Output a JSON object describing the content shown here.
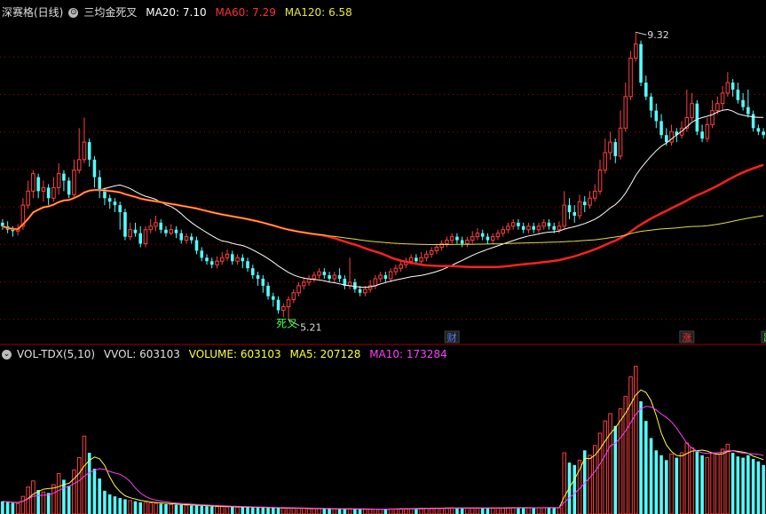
{
  "header_top": {
    "name": "深赛格(日线)",
    "indicator": "三均金死叉",
    "ma20_label": "MA20:",
    "ma20_value": "7.10",
    "ma60_label": "MA60:",
    "ma60_value": "7.29",
    "ma120_label": "MA120:",
    "ma120_value": "6.58"
  },
  "header_bottom": {
    "indicator": "VOL-TDX(5,10)",
    "vvol_label": "VVOL:",
    "vvol_value": "603103",
    "volume_label": "VOLUME:",
    "volume_value": "603103",
    "ma5_label": "MA5:",
    "ma5_value": "207128",
    "ma10_label": "MA10:",
    "ma10_value": "173284"
  },
  "colors": {
    "background": "#000000",
    "up": "#ff4040",
    "down": "#54ffff",
    "ma20": "#ffffff",
    "ma60": "#ff2020",
    "ma120": "#e0e040",
    "vol_ma5": "#ffff40",
    "vol_ma10": "#ff40ff",
    "grid": "#a00000",
    "signal_death": "#40ff40"
  },
  "chart_data": {
    "type": "candlestick",
    "price_ylim": [
      4.9,
      9.5
    ],
    "volume_ylim": [
      0,
      620000
    ],
    "annotations": {
      "high_label": "9.32",
      "low_label": "5.21",
      "death_cross_label": "死叉",
      "markers": [
        {
          "text": "财",
          "index": 88,
          "color": "#5080ff"
        },
        {
          "text": "涨",
          "index": 134,
          "color": "#ff3030"
        },
        {
          "text": "跌",
          "index": 150,
          "color": "#40ff40"
        }
      ]
    },
    "candles": [
      [
        6.6,
        6.55,
        6.65,
        6.5
      ],
      [
        6.55,
        6.5,
        6.62,
        6.45
      ],
      [
        6.5,
        6.48,
        6.55,
        6.4
      ],
      [
        6.48,
        6.5,
        6.58,
        6.42
      ],
      [
        6.55,
        6.85,
        6.95,
        6.5
      ],
      [
        6.85,
        7.05,
        7.2,
        6.8
      ],
      [
        7.05,
        7.3,
        7.35,
        6.95
      ],
      [
        7.25,
        7.05,
        7.3,
        6.95
      ],
      [
        7.05,
        7.1,
        7.2,
        6.9
      ],
      [
        7.1,
        6.95,
        7.15,
        6.85
      ],
      [
        6.95,
        7.1,
        7.25,
        6.9
      ],
      [
        7.1,
        7.3,
        7.45,
        7.0
      ],
      [
        7.3,
        7.2,
        7.35,
        7.05
      ],
      [
        7.2,
        7.0,
        7.25,
        6.95
      ],
      [
        7.0,
        7.35,
        7.5,
        6.95
      ],
      [
        7.35,
        7.5,
        7.95,
        7.3
      ],
      [
        7.5,
        7.75,
        8.1,
        7.45
      ],
      [
        7.75,
        7.5,
        7.8,
        7.4
      ],
      [
        7.5,
        7.25,
        7.55,
        7.1
      ],
      [
        7.25,
        7.05,
        7.35,
        6.95
      ],
      [
        7.05,
        6.95,
        7.1,
        6.85
      ],
      [
        6.95,
        6.9,
        7.0,
        6.8
      ],
      [
        6.9,
        6.85,
        6.95,
        6.75
      ],
      [
        6.85,
        6.75,
        6.9,
        6.5
      ],
      [
        6.75,
        6.4,
        6.8,
        6.35
      ],
      [
        6.4,
        6.5,
        6.6,
        6.35
      ],
      [
        6.5,
        6.45,
        6.6,
        6.4
      ],
      [
        6.45,
        6.3,
        6.55,
        6.25
      ],
      [
        6.3,
        6.5,
        6.55,
        6.25
      ],
      [
        6.5,
        6.55,
        6.65,
        6.45
      ],
      [
        6.55,
        6.6,
        6.7,
        6.48
      ],
      [
        6.6,
        6.5,
        6.65,
        6.45
      ],
      [
        6.5,
        6.45,
        6.55,
        6.4
      ],
      [
        6.45,
        6.5,
        6.58,
        6.42
      ],
      [
        6.5,
        6.45,
        6.55,
        6.38
      ],
      [
        6.45,
        6.35,
        6.5,
        6.3
      ],
      [
        6.35,
        6.4,
        6.45,
        6.3
      ],
      [
        6.4,
        6.35,
        6.45,
        6.3
      ],
      [
        6.35,
        6.2,
        6.4,
        6.15
      ],
      [
        6.2,
        6.1,
        6.25,
        6.05
      ],
      [
        6.1,
        6.05,
        6.15,
        6.0
      ],
      [
        6.05,
        6.0,
        6.1,
        5.95
      ],
      [
        6.0,
        6.05,
        6.12,
        5.95
      ],
      [
        6.05,
        6.1,
        6.18,
        6.0
      ],
      [
        6.1,
        6.15,
        6.22,
        6.05
      ],
      [
        6.15,
        6.05,
        6.2,
        6.0
      ],
      [
        6.05,
        6.1,
        6.15,
        6.0
      ],
      [
        6.1,
        6.05,
        6.15,
        5.95
      ],
      [
        6.05,
        5.95,
        6.1,
        5.9
      ],
      [
        5.95,
        5.85,
        6.0,
        5.8
      ],
      [
        5.85,
        5.8,
        5.9,
        5.7
      ],
      [
        5.8,
        5.7,
        5.85,
        5.6
      ],
      [
        5.7,
        5.55,
        5.75,
        5.5
      ],
      [
        5.55,
        5.5,
        5.6,
        5.4
      ],
      [
        5.5,
        5.35,
        5.55,
        5.3
      ],
      [
        5.35,
        5.4,
        5.45,
        5.25
      ],
      [
        5.4,
        5.5,
        5.55,
        5.21
      ],
      [
        5.5,
        5.6,
        5.65,
        5.45
      ],
      [
        5.6,
        5.7,
        5.75,
        5.55
      ],
      [
        5.7,
        5.75,
        5.82,
        5.65
      ],
      [
        5.75,
        5.8,
        5.85,
        5.7
      ],
      [
        5.8,
        5.85,
        5.9,
        5.75
      ],
      [
        5.85,
        5.9,
        5.95,
        5.8
      ],
      [
        5.9,
        5.85,
        5.95,
        5.8
      ],
      [
        5.85,
        5.8,
        5.9,
        5.75
      ],
      [
        5.8,
        5.85,
        5.9,
        5.75
      ],
      [
        5.85,
        5.8,
        5.95,
        5.75
      ],
      [
        5.8,
        5.7,
        5.85,
        5.65
      ],
      [
        5.7,
        5.75,
        6.1,
        5.65
      ],
      [
        5.75,
        5.65,
        5.8,
        5.6
      ],
      [
        5.65,
        5.6,
        5.7,
        5.55
      ],
      [
        5.6,
        5.65,
        5.7,
        5.55
      ],
      [
        5.65,
        5.7,
        5.78,
        5.6
      ],
      [
        5.7,
        5.8,
        5.85,
        5.65
      ],
      [
        5.8,
        5.85,
        5.9,
        5.75
      ],
      [
        5.85,
        5.8,
        5.9,
        5.75
      ],
      [
        5.8,
        5.9,
        5.95,
        5.75
      ],
      [
        5.9,
        5.95,
        6.0,
        5.85
      ],
      [
        5.95,
        6.0,
        6.05,
        5.9
      ],
      [
        6.0,
        6.05,
        6.1,
        5.95
      ],
      [
        6.05,
        6.1,
        6.15,
        6.0
      ],
      [
        6.1,
        6.05,
        6.15,
        6.0
      ],
      [
        6.05,
        6.1,
        6.18,
        6.0
      ],
      [
        6.1,
        6.15,
        6.2,
        6.05
      ],
      [
        6.15,
        6.2,
        6.25,
        6.1
      ],
      [
        6.2,
        6.25,
        6.3,
        6.15
      ],
      [
        6.25,
        6.3,
        6.35,
        6.2
      ],
      [
        6.3,
        6.35,
        6.4,
        6.25
      ],
      [
        6.35,
        6.4,
        6.45,
        6.3
      ],
      [
        6.4,
        6.35,
        6.45,
        6.3
      ],
      [
        6.35,
        6.3,
        6.4,
        6.25
      ],
      [
        6.3,
        6.35,
        6.4,
        6.25
      ],
      [
        6.35,
        6.4,
        6.48,
        6.3
      ],
      [
        6.4,
        6.45,
        6.52,
        6.35
      ],
      [
        6.45,
        6.4,
        6.5,
        6.35
      ],
      [
        6.4,
        6.35,
        6.45,
        6.3
      ],
      [
        6.35,
        6.4,
        6.45,
        6.3
      ],
      [
        6.4,
        6.45,
        6.5,
        6.35
      ],
      [
        6.45,
        6.5,
        6.55,
        6.4
      ],
      [
        6.5,
        6.55,
        6.6,
        6.45
      ],
      [
        6.55,
        6.6,
        6.65,
        6.5
      ],
      [
        6.6,
        6.55,
        6.65,
        6.5
      ],
      [
        6.55,
        6.5,
        6.6,
        6.45
      ],
      [
        6.5,
        6.55,
        6.6,
        6.45
      ],
      [
        6.55,
        6.5,
        6.6,
        6.45
      ],
      [
        6.5,
        6.55,
        6.6,
        6.45
      ],
      [
        6.55,
        6.6,
        6.65,
        6.5
      ],
      [
        6.6,
        6.55,
        6.65,
        6.5
      ],
      [
        6.55,
        6.5,
        6.6,
        6.45
      ],
      [
        6.5,
        6.55,
        6.62,
        6.45
      ],
      [
        6.55,
        6.85,
        7.05,
        6.5
      ],
      [
        6.85,
        6.75,
        6.95,
        6.65
      ],
      [
        6.75,
        6.7,
        6.85,
        6.6
      ],
      [
        6.7,
        6.9,
        7.0,
        6.65
      ],
      [
        6.9,
        6.85,
        6.98,
        6.75
      ],
      [
        6.85,
        6.95,
        7.05,
        6.8
      ],
      [
        6.95,
        7.05,
        7.15,
        6.9
      ],
      [
        7.05,
        7.35,
        7.5,
        7.0
      ],
      [
        7.35,
        7.6,
        7.8,
        7.3
      ],
      [
        7.6,
        7.75,
        7.9,
        7.5
      ],
      [
        7.75,
        7.55,
        7.8,
        7.45
      ],
      [
        7.55,
        7.95,
        8.2,
        7.5
      ],
      [
        7.95,
        8.4,
        8.6,
        7.9
      ],
      [
        8.4,
        8.95,
        9.05,
        8.35
      ],
      [
        8.95,
        9.15,
        9.32,
        8.9
      ],
      [
        9.15,
        8.6,
        9.2,
        8.55
      ],
      [
        8.6,
        8.4,
        8.7,
        8.35
      ],
      [
        8.4,
        8.2,
        8.45,
        8.1
      ],
      [
        8.2,
        8.05,
        8.3,
        7.95
      ],
      [
        8.05,
        7.85,
        8.15,
        7.8
      ],
      [
        7.85,
        7.75,
        7.95,
        7.7
      ],
      [
        7.75,
        7.9,
        8.0,
        7.7
      ],
      [
        7.9,
        7.85,
        7.95,
        7.75
      ],
      [
        7.85,
        7.95,
        8.05,
        7.8
      ],
      [
        7.95,
        8.1,
        8.5,
        7.9
      ],
      [
        8.1,
        8.3,
        8.45,
        8.05
      ],
      [
        8.3,
        7.9,
        8.35,
        7.85
      ],
      [
        7.9,
        7.8,
        8.0,
        7.75
      ],
      [
        7.8,
        8.0,
        8.1,
        7.75
      ],
      [
        8.0,
        8.2,
        8.35,
        7.95
      ],
      [
        8.2,
        8.3,
        8.4,
        8.15
      ],
      [
        8.3,
        8.45,
        8.55,
        8.2
      ],
      [
        8.45,
        8.6,
        8.75,
        8.4
      ],
      [
        8.6,
        8.5,
        8.65,
        8.4
      ],
      [
        8.5,
        8.35,
        8.6,
        8.3
      ],
      [
        8.35,
        8.25,
        8.45,
        8.2
      ],
      [
        8.25,
        8.15,
        8.5,
        8.1
      ],
      [
        8.15,
        7.95,
        8.2,
        7.9
      ],
      [
        7.95,
        7.9,
        8.0,
        7.85
      ],
      [
        7.9,
        7.85,
        7.95,
        7.8
      ]
    ],
    "volume": [
      52000,
      48000,
      45000,
      43000,
      72000,
      110000,
      135000,
      98000,
      90000,
      86000,
      120000,
      165000,
      140000,
      115000,
      180000,
      230000,
      318000,
      250000,
      185000,
      145000,
      95000,
      80000,
      72000,
      65000,
      60000,
      55000,
      52000,
      48000,
      47000,
      45000,
      44000,
      42000,
      40000,
      39000,
      38000,
      37000,
      36000,
      35000,
      34000,
      33000,
      32000,
      31000,
      30000,
      30000,
      29000,
      29000,
      28000,
      28000,
      27000,
      27000,
      26000,
      26000,
      25000,
      25000,
      25000,
      24000,
      24000,
      23000,
      23000,
      23000,
      22000,
      22000,
      22000,
      21000,
      21000,
      21000,
      20000,
      20000,
      22000,
      20000,
      19000,
      19000,
      19000,
      20000,
      20000,
      20000,
      21000,
      21000,
      22000,
      22000,
      22000,
      23000,
      23000,
      23000,
      24000,
      24000,
      24000,
      25000,
      25000,
      25000,
      24000,
      24000,
      24000,
      25000,
      25000,
      24000,
      24000,
      25000,
      25000,
      26000,
      26000,
      26000,
      25000,
      25000,
      25000,
      26000,
      26000,
      26000,
      25000,
      25000,
      250000,
      210000,
      200000,
      220000,
      260000,
      240000,
      280000,
      330000,
      380000,
      410000,
      360000,
      430000,
      480000,
      560000,
      603103,
      460000,
      380000,
      310000,
      260000,
      240000,
      220000,
      245000,
      230000,
      250000,
      290000,
      270000,
      255000,
      240000,
      230000,
      250000,
      245000,
      265000,
      285000,
      250000,
      235000,
      230000,
      240000,
      225000,
      215000,
      200000
    ]
  }
}
